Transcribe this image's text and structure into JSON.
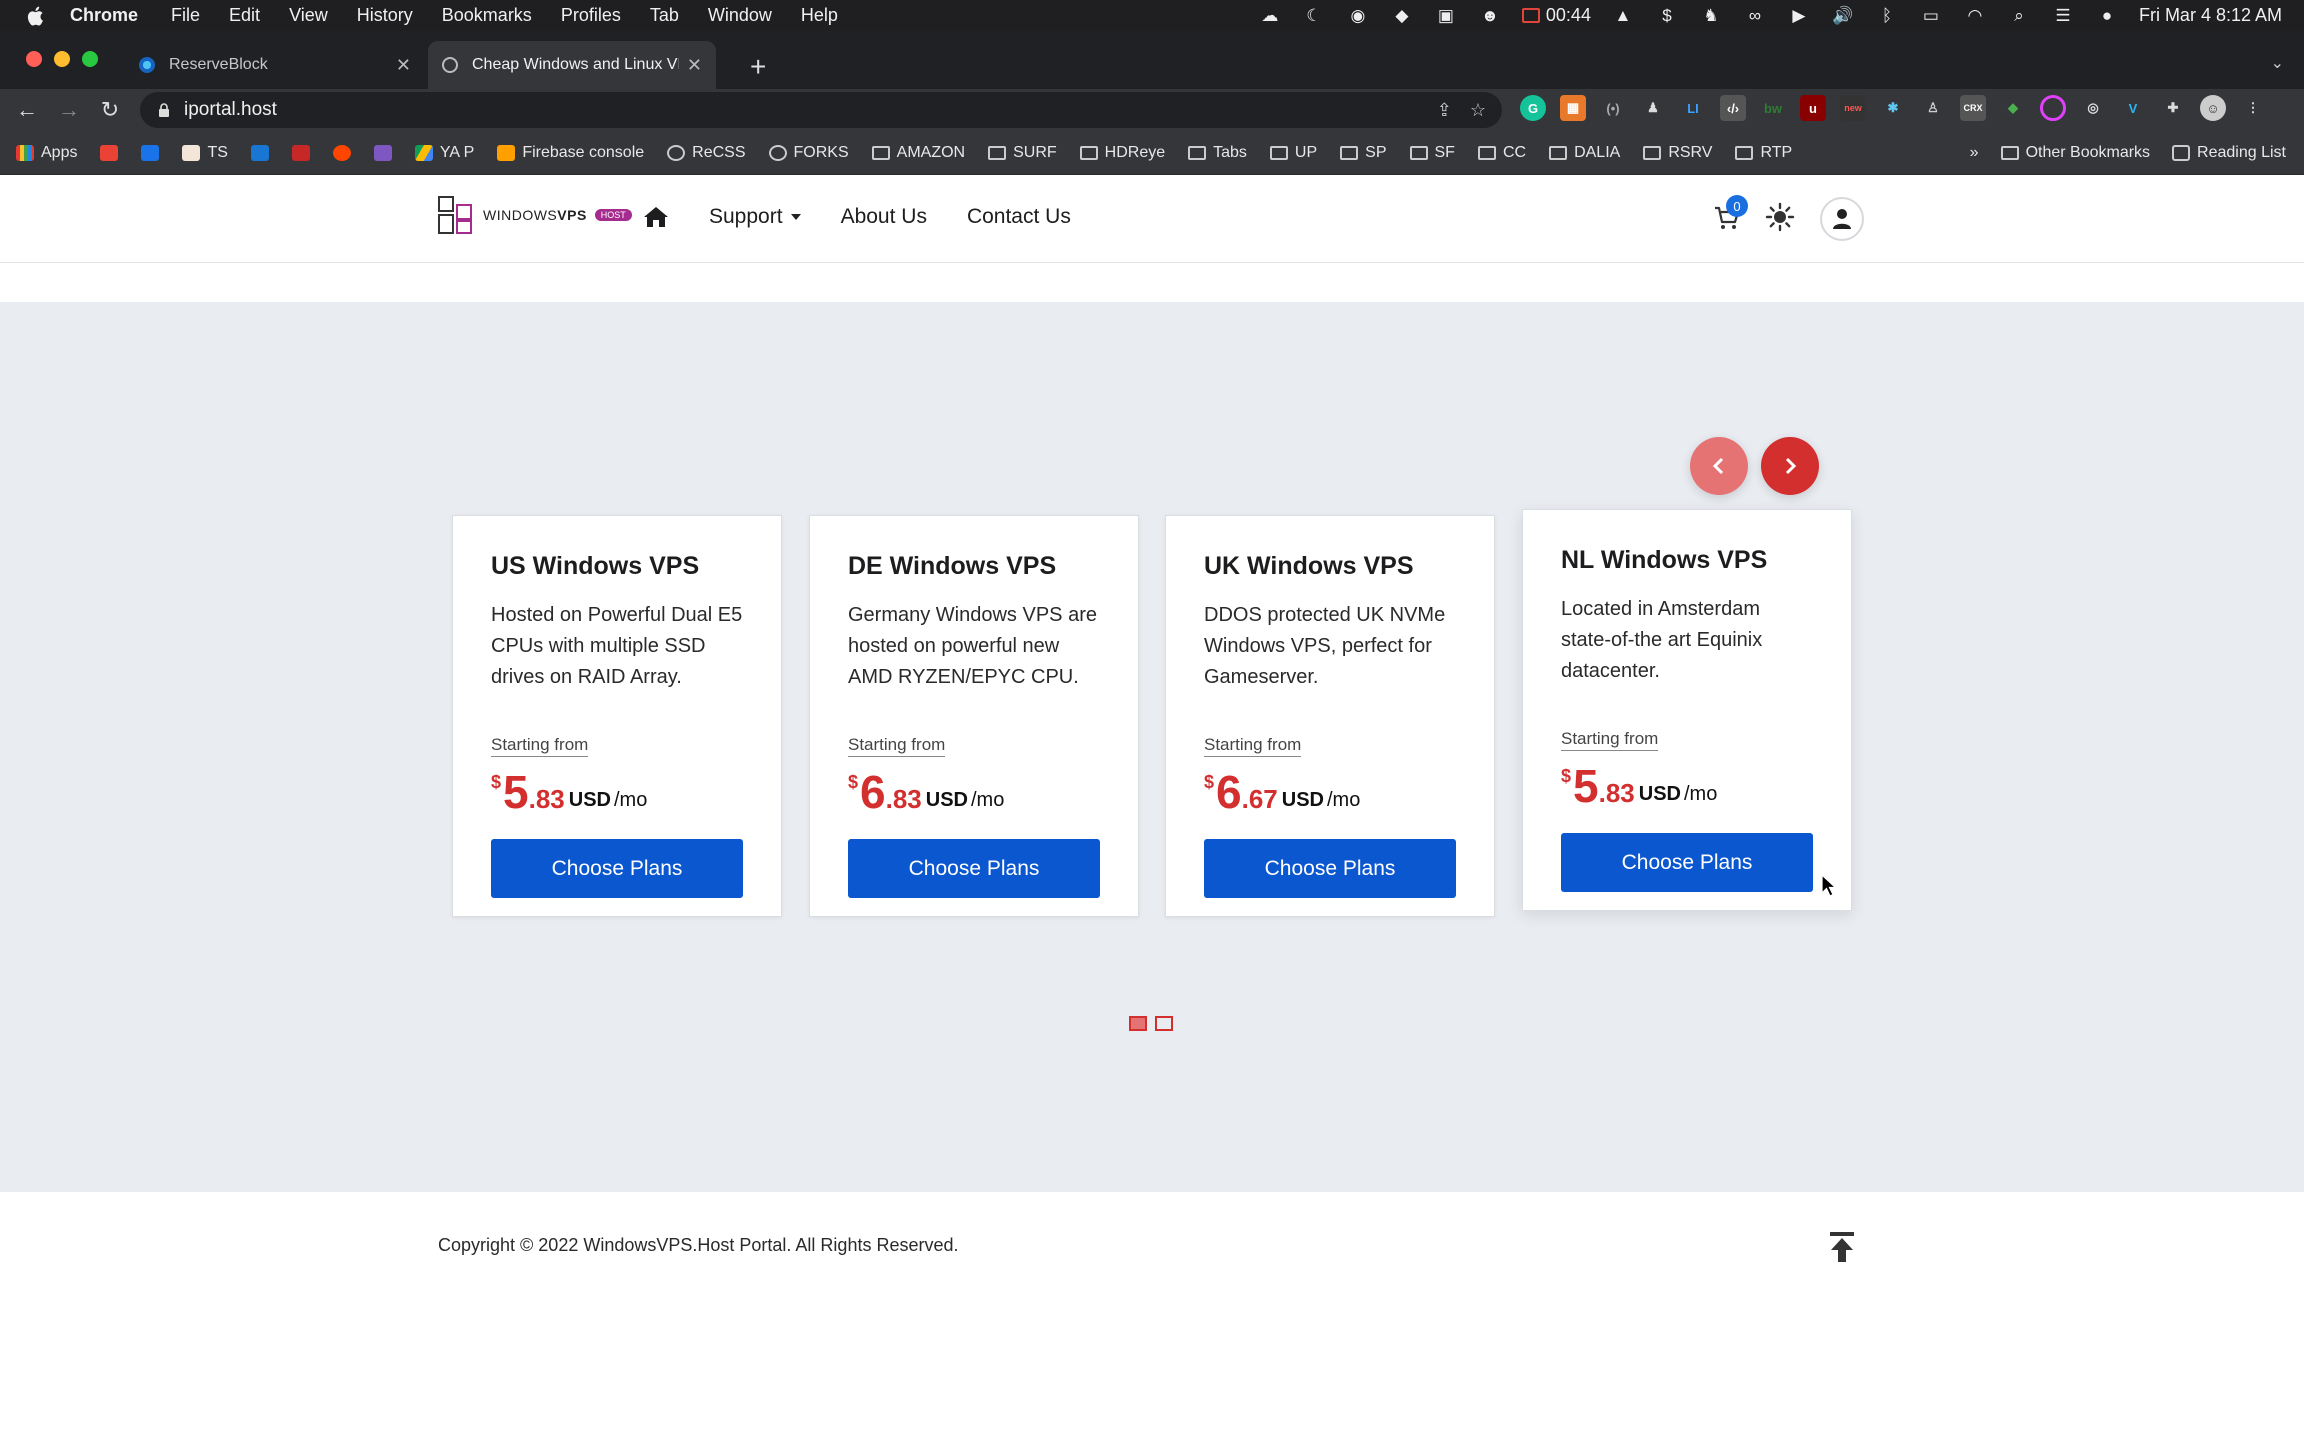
{
  "menubar": {
    "app": "Chrome",
    "items": [
      "File",
      "Edit",
      "View",
      "History",
      "Bookmarks",
      "Profiles",
      "Tab",
      "Window",
      "Help"
    ],
    "timer": "00:44",
    "datetime": "Fri Mar 4  8:12 AM"
  },
  "browser": {
    "tabs": [
      {
        "title": "ReserveBlock",
        "active": false
      },
      {
        "title": "Cheap Windows and Linux VPS",
        "active": true
      }
    ],
    "url": "iportal.host",
    "bookmarks": [
      {
        "label": "Apps",
        "type": "apps"
      },
      {
        "label": "",
        "type": "gmail"
      },
      {
        "label": "",
        "type": "cal"
      },
      {
        "label": "TS",
        "type": "site"
      },
      {
        "label": "",
        "type": "site"
      },
      {
        "label": "",
        "type": "site"
      },
      {
        "label": "",
        "type": "site"
      },
      {
        "label": "",
        "type": "site"
      },
      {
        "label": "YA P",
        "type": "drive"
      },
      {
        "label": "Firebase console",
        "type": "firebase"
      },
      {
        "label": "ReCSS",
        "type": "globe"
      },
      {
        "label": "FORKS",
        "type": "globe"
      },
      {
        "label": "AMAZON",
        "type": "folder"
      },
      {
        "label": "SURF",
        "type": "folder"
      },
      {
        "label": "HDReye",
        "type": "folder"
      },
      {
        "label": "Tabs",
        "type": "folder"
      },
      {
        "label": "UP",
        "type": "folder"
      },
      {
        "label": "SP",
        "type": "folder"
      },
      {
        "label": "SF",
        "type": "folder"
      },
      {
        "label": "CC",
        "type": "folder"
      },
      {
        "label": "DALIA",
        "type": "folder"
      },
      {
        "label": "RSRV",
        "type": "folder"
      },
      {
        "label": "RTP",
        "type": "folder"
      }
    ],
    "overflow": "»",
    "other_bookmarks": "Other Bookmarks",
    "reading_list": "Reading List"
  },
  "site": {
    "logo": {
      "part1": "WINDOWS",
      "part2": "VPS",
      "pill": "HOST"
    },
    "nav": {
      "support": "Support",
      "about": "About Us",
      "contact": "Contact Us"
    },
    "cart_count": "0",
    "plans": [
      {
        "title": "US Windows VPS",
        "desc": "Hosted on Powerful Dual E5 CPUs with multiple SSD drives on RAID Array.",
        "from": "Starting from",
        "currency": "$",
        "int": "5",
        "dec": ".83",
        "unit": "USD",
        "per": "/mo",
        "button": "Choose Plans"
      },
      {
        "title": "DE Windows VPS",
        "desc": "Germany Windows VPS are hosted on powerful new AMD RYZEN/EPYC CPU.",
        "from": "Starting from",
        "currency": "$",
        "int": "6",
        "dec": ".83",
        "unit": "USD",
        "per": "/mo",
        "button": "Choose Plans"
      },
      {
        "title": "UK Windows VPS",
        "desc": "DDOS protected UK NVMe Windows VPS, perfect for Gameserver.",
        "from": "Starting from",
        "currency": "$",
        "int": "6",
        "dec": ".67",
        "unit": "USD",
        "per": "/mo",
        "button": "Choose Plans"
      },
      {
        "title": "NL Windows VPS",
        "desc": "Located in Amsterdam state-of-the art Equinix datacenter.",
        "from": "Starting from",
        "currency": "$",
        "int": "5",
        "dec": ".83",
        "unit": "USD",
        "per": "/mo",
        "button": "Choose Plans"
      }
    ],
    "pagination": {
      "pages": 2,
      "current": 1
    },
    "footer": {
      "copyright": "Copyright © 2022 WindowsVPS.Host Portal. All Rights Reserved."
    }
  },
  "colors": {
    "accent_red": "#d32f2f",
    "button_blue": "#0b57cf",
    "hero_bg": "#e9ecf1"
  }
}
